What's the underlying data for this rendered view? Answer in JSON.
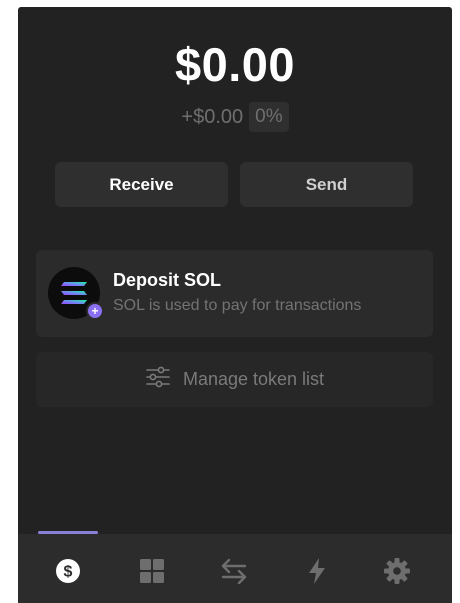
{
  "wallet": {
    "balance": "$0.00",
    "change_amount": "+$0.00",
    "change_percent": "0%"
  },
  "actions": {
    "receive_label": "Receive",
    "send_label": "Send"
  },
  "deposit_card": {
    "title": "Deposit SOL",
    "subtitle": "SOL is used to pay for transactions",
    "icon": "solana-logo-icon",
    "badge_icon": "plus-icon"
  },
  "manage_tokens": {
    "label": "Manage token list",
    "icon": "sliders-icon"
  },
  "tabs": [
    {
      "name": "wallet",
      "icon": "dollar-circle-icon",
      "active": true
    },
    {
      "name": "collectibles",
      "icon": "grid-icon",
      "active": false
    },
    {
      "name": "swap",
      "icon": "arrows-swap-icon",
      "active": false
    },
    {
      "name": "activity",
      "icon": "lightning-icon",
      "active": false
    },
    {
      "name": "settings",
      "icon": "gear-icon",
      "active": false
    }
  ],
  "colors": {
    "background": "#222222",
    "card": "#2b2b2b",
    "accent": "#8a7fd8",
    "text_primary": "#ffffff",
    "text_muted": "#737373"
  }
}
